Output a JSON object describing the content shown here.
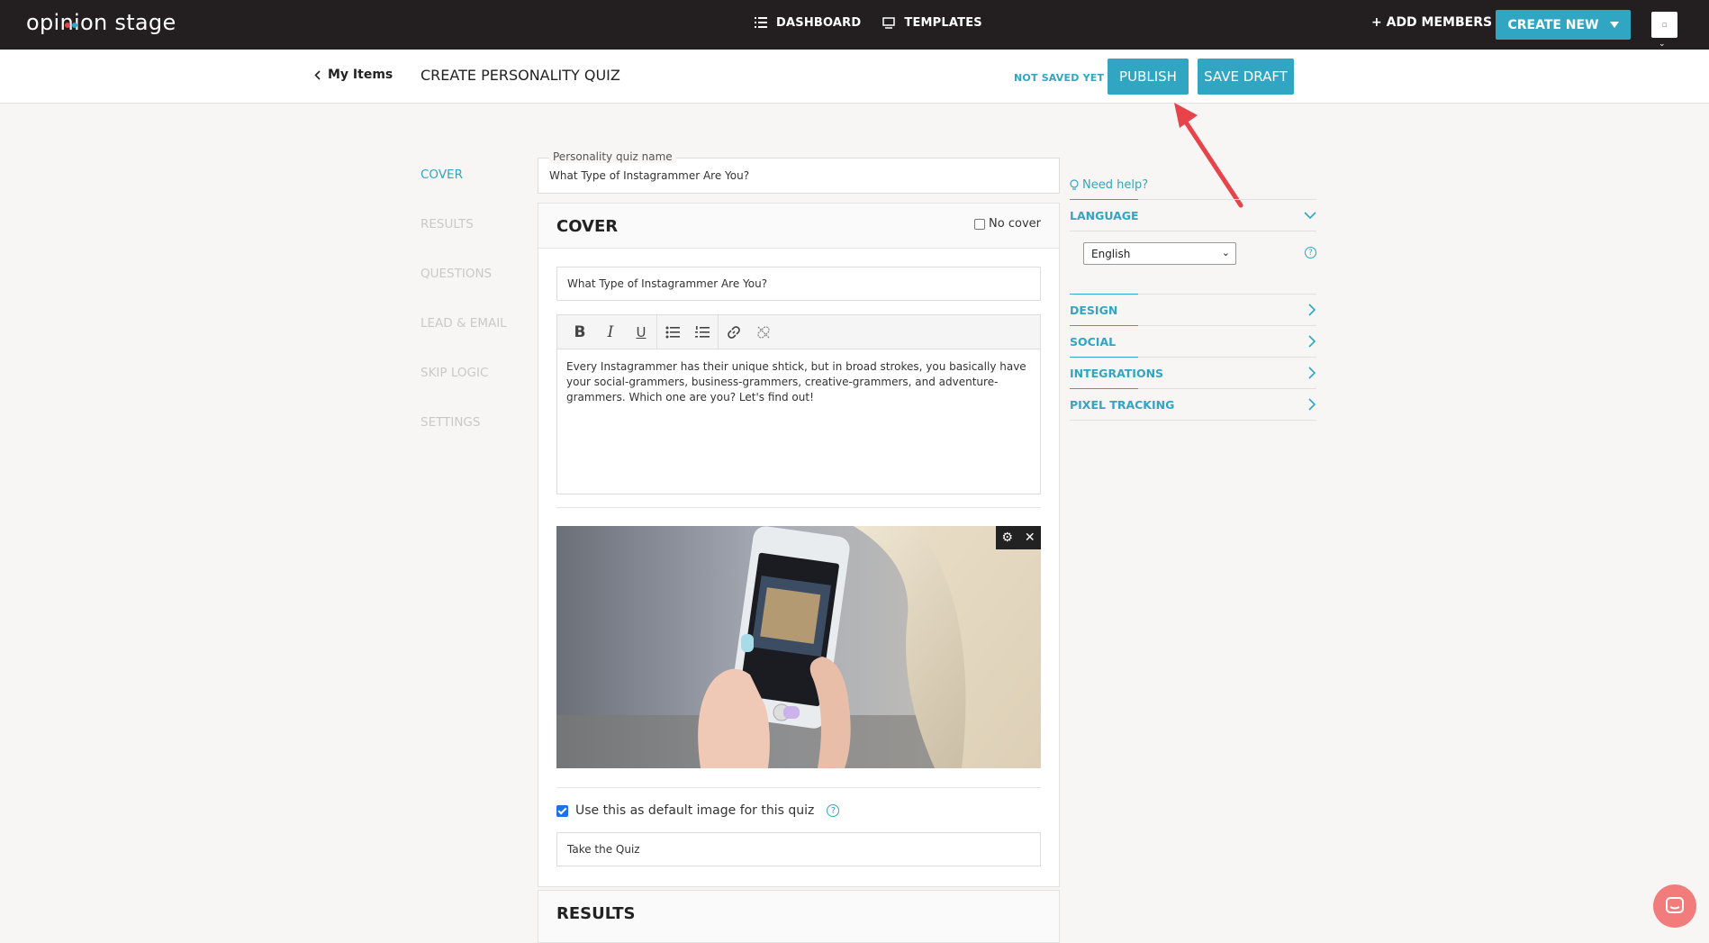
{
  "topbar": {
    "logo": "opinion stage",
    "nav": [
      {
        "label": "DASHBOARD"
      },
      {
        "label": "TEMPLATES"
      }
    ],
    "add_members": "+ ADD MEMBERS",
    "create_new": "CREATE NEW"
  },
  "subheader": {
    "back_label": "My Items",
    "title": "CREATE PERSONALITY QUIZ",
    "status": "NOT SAVED YET",
    "publish": "PUBLISH",
    "save_draft": "SAVE DRAFT"
  },
  "leftnav": [
    "COVER",
    "RESULTS",
    "QUESTIONS",
    "LEAD & EMAIL",
    "SKIP LOGIC",
    "SETTINGS"
  ],
  "quiz_name": {
    "label": "Personality quiz name",
    "value": "What Type of Instagrammer Are You?"
  },
  "cover": {
    "heading": "COVER",
    "no_cover": "No cover",
    "title_value": "What Type of Instagrammer Are You?",
    "description": "Every Instagrammer has their unique shtick, but in broad strokes, you basically have your social-grammers, business-grammers, creative-grammers, and adventure-grammers. Which one are you? Let's find out!",
    "default_image_label": "Use this as default image for this quiz",
    "button_text": "Take the Quiz"
  },
  "results": {
    "heading": "RESULTS"
  },
  "right_panel": {
    "need_help": "Need help?",
    "language": {
      "label": "LANGUAGE",
      "value": "English"
    },
    "sections": [
      "DESIGN",
      "SOCIAL",
      "INTEGRATIONS",
      "PIXEL TRACKING"
    ]
  },
  "colors": {
    "brand": "#30a6c3",
    "topbar": "#231f20",
    "arrow": "#e8424a"
  }
}
